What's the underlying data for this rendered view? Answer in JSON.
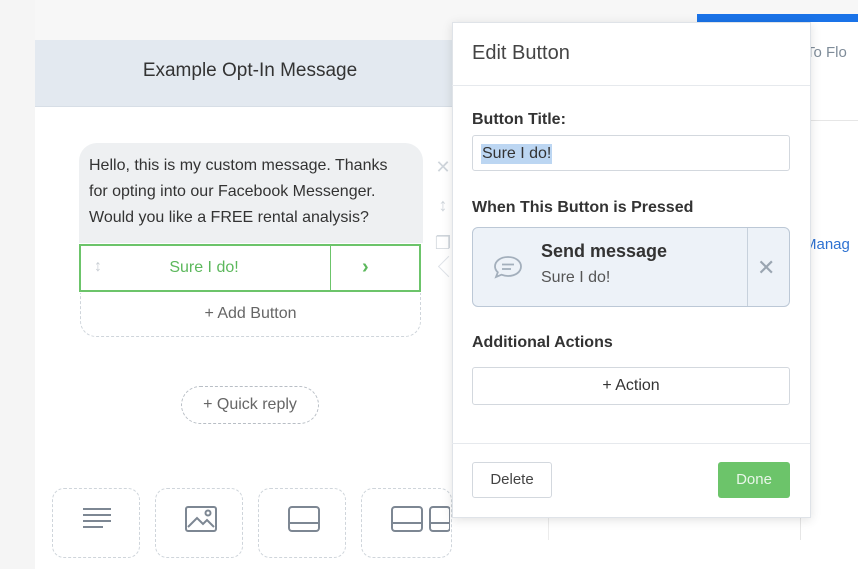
{
  "card": {
    "title": "Example Opt-In Message",
    "message": "Hello, this is my custom message. Thanks\nfor opting into our Facebook Messenger.\nWould you like a FREE rental analysis?",
    "button_label": "Sure I do!",
    "add_button": "+ Add Button",
    "quick_reply": "+ Quick reply"
  },
  "right_strip": {
    "text1": "To Flo",
    "text2": "Manag"
  },
  "panel": {
    "title": "Edit Button",
    "button_title_label": "Button Title:",
    "button_title_value": "Sure I do!",
    "when_pressed_label": "When This Button is Pressed",
    "action_title": "Send message",
    "action_subtitle": "Sure I do!",
    "additional_label": "Additional Actions",
    "add_action": "+ Action",
    "delete": "Delete",
    "done": "Done"
  },
  "colors": {
    "accent_green": "#6cc46a",
    "header_bg": "#e3e9f0",
    "link_blue": "#2e72d2"
  },
  "icons": [
    "drag-handle-icon",
    "chevron-right-icon",
    "close-icon",
    "reorder-icon",
    "copy-icon",
    "message-icon",
    "text-block-icon",
    "image-icon",
    "card-icon",
    "gallery-icon"
  ]
}
